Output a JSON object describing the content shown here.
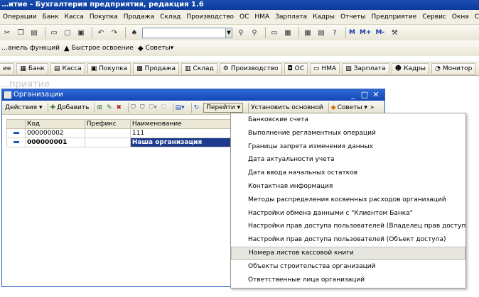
{
  "window": {
    "title": "…итие - Бухгалтерия предприятия, редакция 1.6"
  },
  "menubar": [
    "Операции",
    "Банк",
    "Касса",
    "Покупка",
    "Продажа",
    "Склад",
    "Производство",
    "ОС",
    "НМА",
    "Зарплата",
    "Кадры",
    "Отчеты",
    "Предприятие",
    "Сервис",
    "Окна",
    "Справка"
  ],
  "toolbar1": {
    "m_buttons": [
      "M",
      "M+",
      "M-"
    ]
  },
  "toolbar2": {
    "panel_functions": "…анель функций",
    "quick_start": "Быстрое освоение",
    "tips": "Советы"
  },
  "panel_tabs": [
    "ие",
    "Банк",
    "Касса",
    "Покупка",
    "Продажа",
    "Склад",
    "Производство",
    "ОС",
    "НМА",
    "Зарплата",
    "Кадры",
    "Монитор"
  ],
  "background_title": "…приятие",
  "child_window": {
    "title": "Организации",
    "toolbar": {
      "actions": "Действия",
      "add": "Добавить",
      "goto": "Перейти",
      "set_main": "Установить основной",
      "tips": "Советы"
    },
    "columns": [
      "Код",
      "Префикс",
      "Наименование"
    ],
    "rows": [
      {
        "code": "000000002",
        "prefix": "",
        "name": "111"
      },
      {
        "code": "000000001",
        "prefix": "",
        "name": "Наша организация"
      }
    ]
  },
  "dropdown": {
    "items": [
      "Банковские счета",
      "Выполнение регламентных операций",
      "Границы запрета изменения данных",
      "Дата актуальности учета",
      "Дата ввода начальных остатков",
      "Контактная информация",
      "Методы распределения косвенных расходов организаций",
      "Настройки обмена данными с \"Клиентом Банка\"",
      "Настройки прав доступа пользователей (Владелец прав доступа)",
      "Настройки прав доступа пользователей (Объект доступа)",
      "Номера листов кассовой книги",
      "Объекты строительства организаций",
      "Ответственные лица организаций"
    ],
    "highlighted_index": 10
  }
}
